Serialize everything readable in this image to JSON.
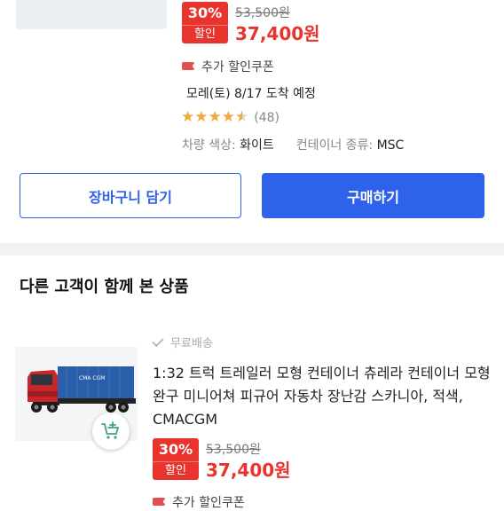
{
  "top_product": {
    "discount_pct": "30%",
    "discount_label": "할인",
    "original_price": "53,500원",
    "sale_price": "37,400원",
    "coupon_text": "추가 할인쿠폰",
    "delivery_text": "모레(토) 8/17 도착 예정",
    "rating": 4.5,
    "review_count": "(48)",
    "option_color_label": "차량 색상:",
    "option_color_value": "화이트",
    "option_container_label": "컨테이너 종류:",
    "option_container_value": "MSC"
  },
  "actions": {
    "cart_label": "장바구니 담기",
    "buy_label": "구매하기"
  },
  "section": {
    "title": "다른 고객이 함께 본 상품"
  },
  "rec_product": {
    "free_shipping": "무료배송",
    "title": "1:32 트럭 트레일러 모형 컨테이너 츄레라 컨테이너 모형 완구 미니어쳐 피규어 자동차 장난감 스카니아, 적색, CMACGM",
    "container_text": "CMA CGM",
    "discount_pct": "30%",
    "discount_label": "할인",
    "original_price": "53,500원",
    "sale_price": "37,400원",
    "coupon_text": "추가 할인쿠폰"
  },
  "colors": {
    "accent_blue": "#2f62ea",
    "discount_red": "#e8342c",
    "star": "#f0a93b"
  }
}
